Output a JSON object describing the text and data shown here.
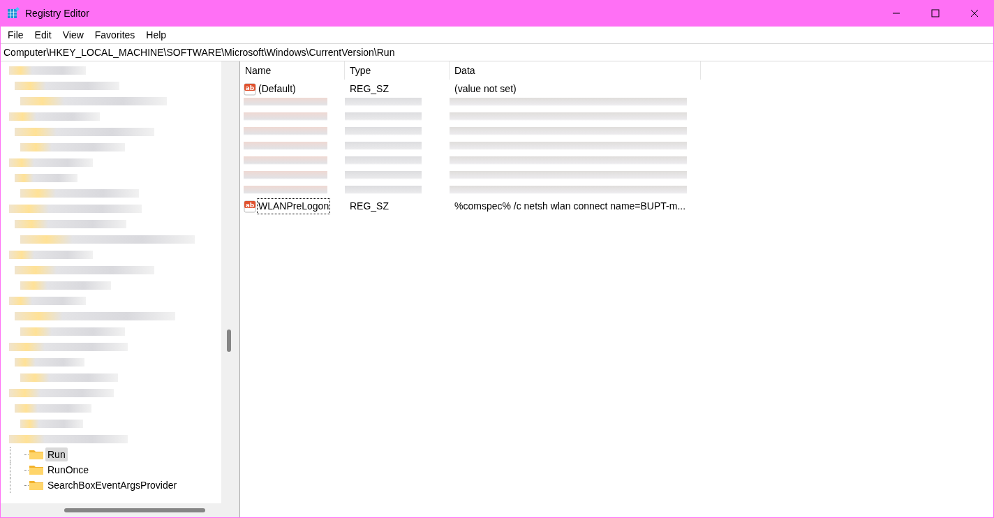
{
  "window": {
    "title": "Registry Editor"
  },
  "menu": [
    {
      "label": "File"
    },
    {
      "label": "Edit"
    },
    {
      "label": "View"
    },
    {
      "label": "Favorites"
    },
    {
      "label": "Help"
    }
  ],
  "address": "Computer\\HKEY_LOCAL_MACHINE\\SOFTWARE\\Microsoft\\Windows\\CurrentVersion\\Run",
  "tree": {
    "items": [
      {
        "label": "Run",
        "selected": true
      },
      {
        "label": "RunOnce",
        "selected": false
      },
      {
        "label": "SearchBoxEventArgsProvider",
        "selected": false
      }
    ]
  },
  "table": {
    "columns": [
      "Name",
      "Type",
      "Data"
    ],
    "rows": [
      {
        "kind": "value",
        "icon": "ab",
        "name": "(Default)",
        "type": "REG_SZ",
        "data": "(value not set)",
        "focused": false
      },
      {
        "kind": "redacted"
      },
      {
        "kind": "value",
        "icon": "ab",
        "name": "WLANPreLogon",
        "type": "REG_SZ",
        "data": "%comspec% /c netsh wlan connect name=BUPT-m...",
        "focused": true
      }
    ]
  }
}
